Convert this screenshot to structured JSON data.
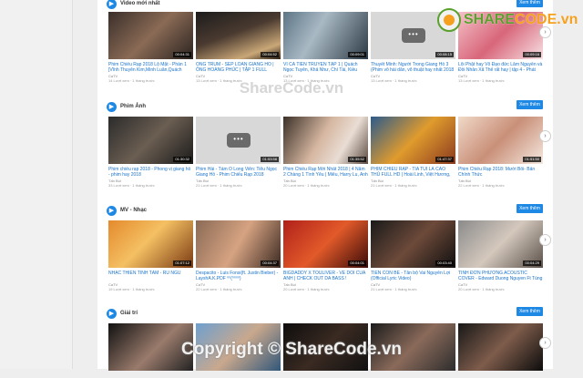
{
  "sections": [
    {
      "title": "Video mới nhất",
      "more": "Xem thêm",
      "items": [
        {
          "title": "Phim Chiếu Rạp 2018 Lộ Mặt - Phần 1 [Vĩnh Thuyên Kim,Minh Luân,Quách Ngọc...",
          "sub": "CaTV",
          "meta": "14 Lượt xem · 1 tháng trước",
          "dur": "00:04:31"
        },
        {
          "title": "ÔNG TRÙM - SÉP LOAN GIANG HỒ | ÔNG HOÀNG PHÚC | TẬP 1 FULL",
          "sub": "CaTV",
          "meta": "13 Lượt xem · 1 tháng trước",
          "dur": "00:04:52"
        },
        {
          "title": "VÌ CÁ TIỀN TRUYỆN TẬP 1 | Quách Ngọc Tuyên, Khả Như, Chí Tài, Kiều Minh Tuấn,...",
          "sub": "CaTV",
          "meta": "13 Lượt xem · 1 tháng trước",
          "dur": "00:09:01"
        },
        {
          "title": "Thuyết Minh: Người Trong Giang Hồ 3 (Phim võ hài dân, võ thuật hay nhất 2018 PHIM B...",
          "sub": "CaTV",
          "meta": "13 Lượt xem · 1 tháng trước",
          "dur": "00:08:15"
        },
        {
          "title": "Lôi Phật hay Vô Đạo đức Lâm Nguyễn và Đồi Nhân Xã Thế rất hay | tập 4 - Phát Phầu...",
          "sub": "CaTV",
          "meta": "13 Lượt xem · 1 tháng trước",
          "dur": "00:09:16"
        }
      ]
    },
    {
      "title": "Phim Ảnh",
      "more": "Xem thêm",
      "items": [
        {
          "title": "Phim chiếu rạp 2018 - Phong vị giang hồ - phim hay 2018",
          "sub": "Tấn Bùi",
          "meta": "33 Lượt xem · 1 tháng trước",
          "dur": "01:30:32"
        },
        {
          "title": "Phim Hài - Tám Ò Long Viên: Tiểu Ngọc Giang Hồ - Phim Chiếu Rạp 2018",
          "sub": "Tấn Bùi",
          "meta": "21 Lượt xem · 1 tháng trước",
          "dur": "01:53:58"
        },
        {
          "title": "Phim Chiếu Rạp Mới Nhất 2018 | 4 Năm 2 Chàng 1 Tình Yêu | Miêu, Harry Lu, Anh Tú",
          "sub": "Tấn Bùi",
          "meta": "20 Lượt xem · 1 tháng trước",
          "dur": "01:35:52"
        },
        {
          "title": "PHIM CHIẾU RẠP - TÍA TUI LÀ CAO THỦ FULL HD | Hoài Linh, Việt Hương, Hoài Lâm...",
          "sub": "Tấn Bùi",
          "meta": "21 Lượt xem · 1 tháng trước",
          "dur": "01:47:37"
        },
        {
          "title": "Phim Chiếu Rạp 2018: Mười Bối- Bản Chính Thức",
          "sub": "Tấn Bùi",
          "meta": "22 Lượt xem · 1 tháng trước",
          "dur": "01:51:50"
        }
      ]
    },
    {
      "title": "MV - Nhạc",
      "more": "Xem thêm",
      "items": [
        {
          "title": "NHẠC THIỀN TĨNH TÂM - RU NGỦ",
          "sub": "CaTV",
          "meta": "19 Lượt xem · 1 tháng trước",
          "dur": "01:07:12"
        },
        {
          "title": "Despacito - Luis Fonsi(ft. Justin Bieber) - LayshA.K.PDF ⁰⁰(⁰⁰⁰⁰)",
          "sub": "CaTV",
          "meta": "22 Lượt xem · 1 tháng trước",
          "dur": "00:04:37"
        },
        {
          "title": "BIGDADDY X TOULIVER - VE DOI CUA ANH | CHECK OUT DA BASS !",
          "sub": "Tấn Bùi",
          "meta": "20 Lượt xem · 1 tháng trước",
          "dur": "00:04:01"
        },
        {
          "title": "TIẾN CON BÉ - Tân bộ Vai Nguyễn Lợi (Official Lyric Video)",
          "sub": "CaTV",
          "meta": "21 Lượt xem · 1 tháng trước",
          "dur": "00:03:40"
        },
        {
          "title": "TÌNH ĐƠN PHƯƠNG ACOUSTIC COVER - Edward Duong Nguyen Ft Tùng Acoustic",
          "sub": "CaTV",
          "meta": "20 Lượt xem · 1 tháng trước",
          "dur": "00:04:29"
        }
      ]
    },
    {
      "title": "Giải trí",
      "more": "Xem thêm",
      "items": []
    }
  ],
  "watermark_center": "ShareCode.vn",
  "watermark_bottom": "Copyright © ShareCode.vn",
  "logo": {
    "part1": "SHARE",
    "part2": "CODE.vn"
  },
  "colors": {
    "accent": "#1e88e5",
    "link": "#1a73c8",
    "logo_orange": "#f6a020",
    "logo_green": "#5aa02c"
  }
}
